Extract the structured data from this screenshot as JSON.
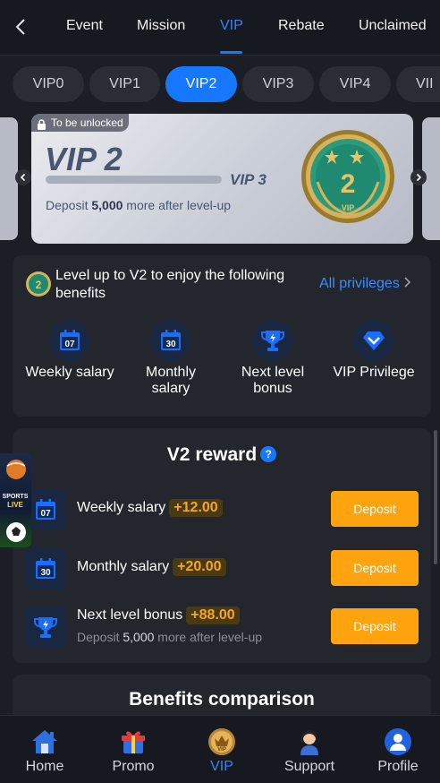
{
  "top_tabs": [
    {
      "label": "Event",
      "active": false
    },
    {
      "label": "Mission",
      "active": false
    },
    {
      "label": "VIP",
      "active": true
    },
    {
      "label": "Rebate",
      "active": false
    },
    {
      "label": "Unclaimed",
      "active": false
    }
  ],
  "vip_levels": [
    "VIP0",
    "VIP1",
    "VIP2",
    "VIP3",
    "VIP4",
    "VII"
  ],
  "vip_selected": "VIP2",
  "card": {
    "lock_label": "To be unlocked",
    "current_level": "VIP 2",
    "next_level": "VIP 3",
    "progress": 0,
    "deposit_prefix": "Deposit",
    "deposit_amount": "5,000",
    "deposit_suffix": "more after level-up",
    "badge_number": "2",
    "badge_text": "VIP"
  },
  "benefits": {
    "title": "Level up to V2 to enjoy the following benefits",
    "all_privileges": "All privileges",
    "items": [
      {
        "label": "Weekly salary",
        "icon": "calendar-07-icon",
        "day": "07"
      },
      {
        "label": "Monthly salary",
        "icon": "calendar-30-icon",
        "day": "30"
      },
      {
        "label": "Next level bonus",
        "icon": "trophy-icon"
      },
      {
        "label": "VIP Privilege",
        "icon": "diamond-icon"
      }
    ]
  },
  "reward": {
    "title": "V2 reward",
    "rows": [
      {
        "name": "Weekly salary",
        "amount": "+12.00",
        "button": "Deposit",
        "icon": "calendar-07-icon",
        "day": "07"
      },
      {
        "name": "Monthly salary",
        "amount": "+20.00",
        "button": "Deposit",
        "icon": "calendar-30-icon",
        "day": "30"
      },
      {
        "name": "Next level bonus",
        "amount": "+88.00",
        "button": "Deposit",
        "icon": "trophy-icon",
        "sub_prefix": "Deposit",
        "sub_amount": "5,000",
        "sub_suffix": "more after level-up"
      }
    ]
  },
  "comparison_title": "Benefits comparison",
  "float_banner": {
    "line1": "SPORTS",
    "line2": "LIVE"
  },
  "bottom_nav": [
    {
      "label": "Home",
      "icon": "home-icon",
      "active": false
    },
    {
      "label": "Promo",
      "icon": "gift-icon",
      "active": false
    },
    {
      "label": "VIP",
      "icon": "vip-crown-icon",
      "active": true
    },
    {
      "label": "Support",
      "icon": "support-agent-icon",
      "active": false
    },
    {
      "label": "Profile",
      "icon": "profile-icon",
      "active": false
    }
  ],
  "colors": {
    "accent": "#1677ff",
    "button": "#ffa40f",
    "amount": "#f6a623",
    "background": "#1b1e25"
  }
}
